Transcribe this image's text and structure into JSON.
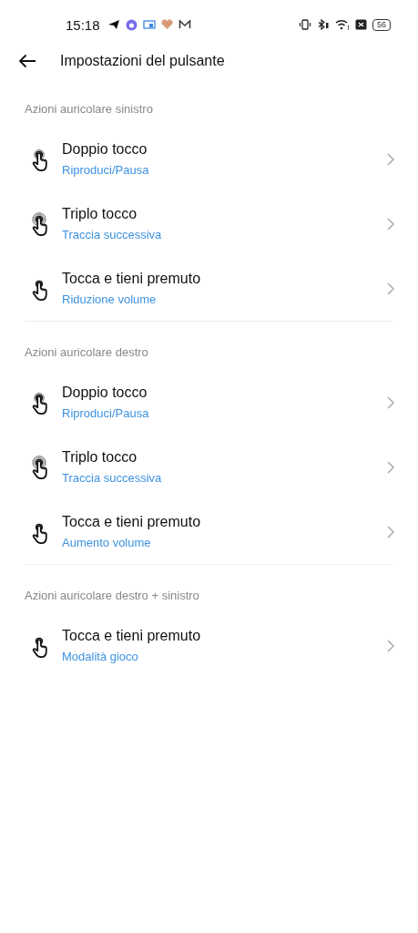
{
  "status_bar": {
    "time": "15:18",
    "battery": "56"
  },
  "header": {
    "title": "Impostazioni del pulsante"
  },
  "sections": [
    {
      "title": "Azioni auricolare sinistro",
      "items": [
        {
          "kind": "double",
          "label": "Doppio tocco",
          "value": "Riproduci/Pausa"
        },
        {
          "kind": "triple",
          "label": "Triplo tocco",
          "value": "Traccia successiva"
        },
        {
          "kind": "hold",
          "label": "Tocca e tieni premuto",
          "value": "Riduzione volume"
        }
      ]
    },
    {
      "title": "Azioni auricolare destro",
      "items": [
        {
          "kind": "double",
          "label": "Doppio tocco",
          "value": "Riproduci/Pausa"
        },
        {
          "kind": "triple",
          "label": "Triplo tocco",
          "value": "Traccia successiva"
        },
        {
          "kind": "hold",
          "label": "Tocca e tieni premuto",
          "value": "Aumento volume"
        }
      ]
    },
    {
      "title": "Azioni auricolare destro + sinistro",
      "items": [
        {
          "kind": "hold",
          "label": "Tocca e tieni premuto",
          "value": "Modalità gioco"
        }
      ]
    }
  ]
}
